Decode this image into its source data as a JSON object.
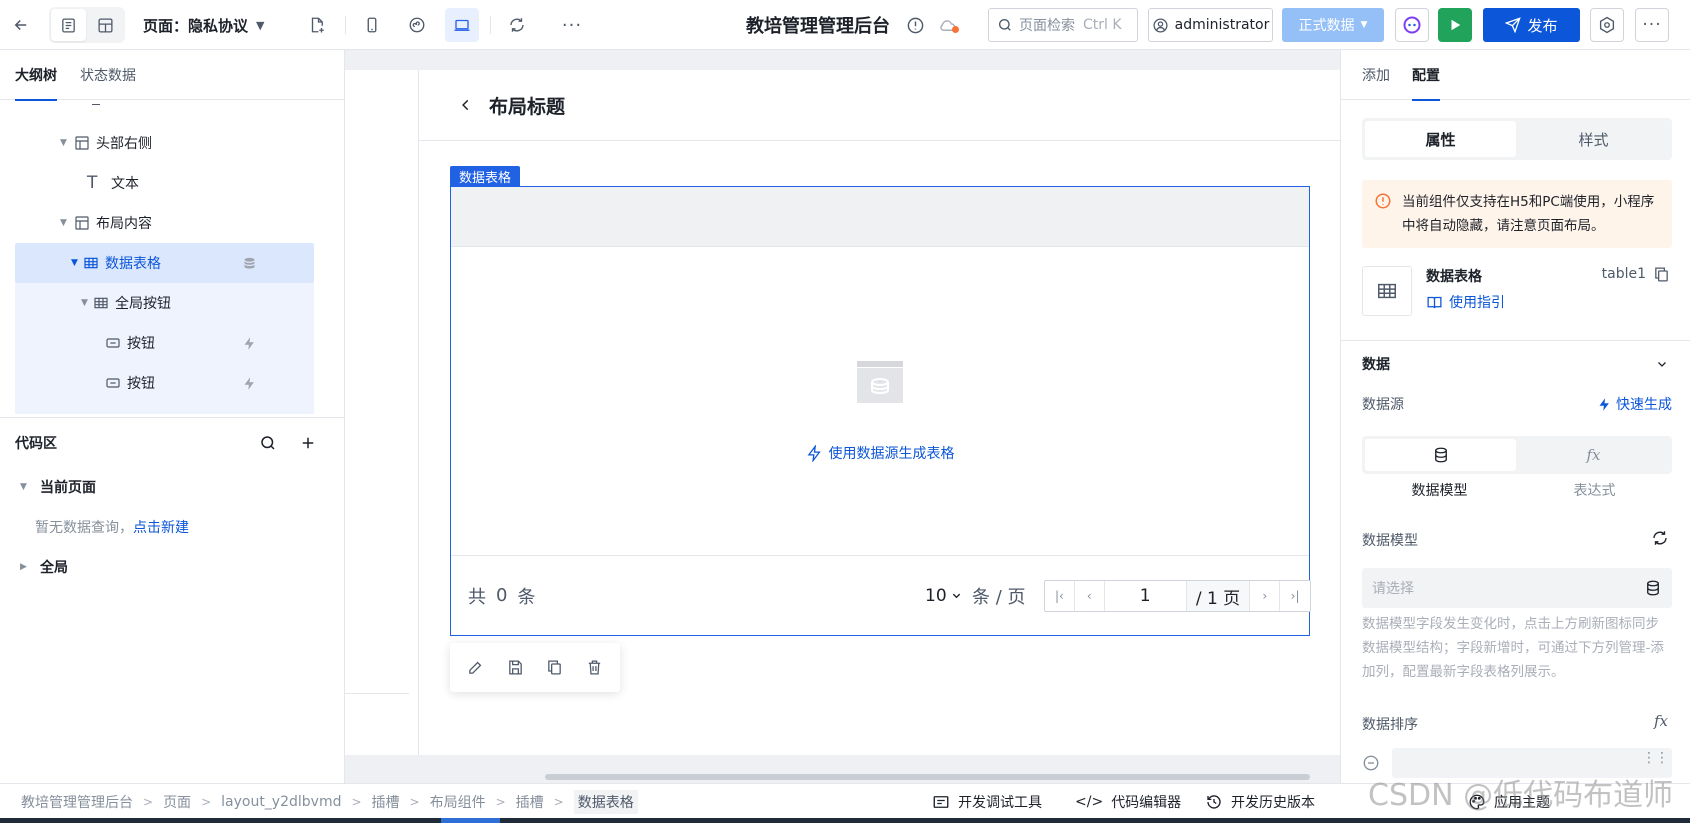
{
  "topbar": {
    "page_label": "页面：隐私协议",
    "app_title": "教培管理管理后台",
    "search": {
      "placeholder": "页面检索",
      "shortcut": "Ctrl K"
    },
    "user": "administrator",
    "env": "正式数据",
    "publish": "发布"
  },
  "left": {
    "tabs": [
      "大纲树",
      "状态数据"
    ],
    "tree": [
      {
        "label": "头部右侧",
        "icon": "layout-icon"
      },
      {
        "label": "文本",
        "icon": "text-icon"
      },
      {
        "label": "布局内容",
        "icon": "layout-icon"
      },
      {
        "label": "数据表格",
        "icon": "table-icon"
      },
      {
        "label": "全局按钮",
        "icon": "table-icon"
      },
      {
        "label": "按钮",
        "icon": "button-icon"
      },
      {
        "label": "按钮",
        "icon": "button-icon"
      }
    ],
    "code": {
      "title": "代码区",
      "current_page": "当前页面",
      "empty_text": "暂无数据查询，",
      "create_link": "点击新建",
      "global": "全局"
    }
  },
  "canvas": {
    "layout_title": "布局标题",
    "component_tag": "数据表格",
    "empty_action": "使用数据源生成表格",
    "pager": {
      "total_prefix": "共",
      "total": "0",
      "total_suffix": "条",
      "page_size": "10",
      "unit": "条 / 页",
      "current_page": "1",
      "total_pages": "/ 1 页"
    }
  },
  "right": {
    "tabs": [
      "添加",
      "配置"
    ],
    "seg": [
      "属性",
      "样式"
    ],
    "alert": "当前组件仅支持在H5和PC端使用，小程序中将自动隐藏，请注意页面布局。",
    "component": {
      "name": "数据表格",
      "id": "table1",
      "guide": "使用指引"
    },
    "section_data": "数据",
    "datasource_label": "数据源",
    "quick_gen": "快速生成",
    "source_tabs": [
      "数据模型",
      "表达式"
    ],
    "model_label": "数据模型",
    "model_placeholder": "请选择",
    "model_help": "数据模型字段发生变化时，点击上方刷新图标同步数据模型结构；字段新增时，可通过下方列管理-添加列，配置最新字段表格列展示。",
    "sort_label": "数据排序"
  },
  "bottom": {
    "crumbs": [
      "教培管理管理后台",
      "页面",
      "layout_y2dlbvmd",
      "插槽",
      "布局组件",
      "插槽",
      "数据表格"
    ],
    "tools": [
      "开发调试工具",
      "代码编辑器",
      "开发历史版本",
      "应用主题"
    ]
  },
  "watermark": "CSDN @低代码布道师",
  "colors": {
    "primary": "#0b56d9",
    "run": "#21a35c",
    "selection": "#2161e3",
    "alert_bg": "#fff4ea"
  }
}
